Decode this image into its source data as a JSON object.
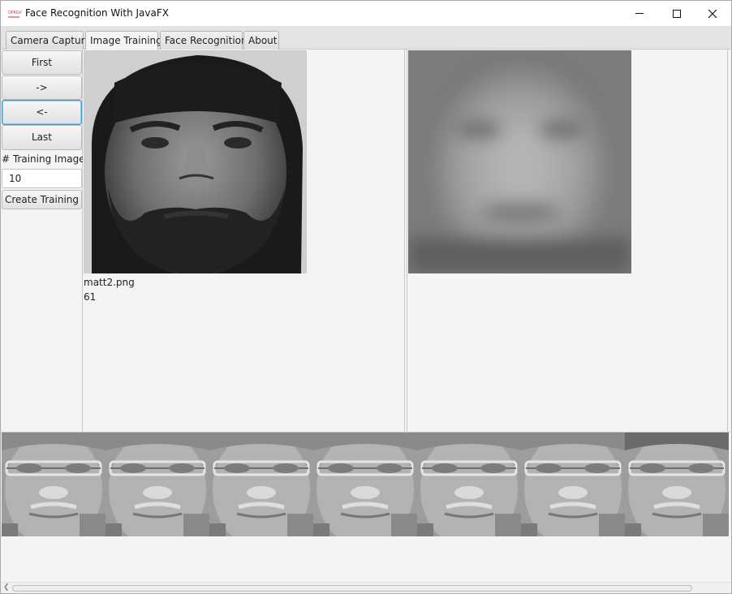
{
  "window": {
    "title": "Face Recognition With JavaFX",
    "icon_text": "OPRGV"
  },
  "tabs": [
    {
      "label": "Camera Capture"
    },
    {
      "label": "Image Training"
    },
    {
      "label": "Face Recognition"
    },
    {
      "label": "About"
    }
  ],
  "active_tab": "Image Training",
  "nav": {
    "first_label": "First",
    "next_label": "->",
    "prev_label": "<-",
    "last_label": "Last"
  },
  "training": {
    "count_label": "# Training Images",
    "count_value": "10",
    "create_label": "Create Training"
  },
  "current_image": {
    "filename": "matt2.png",
    "value": "61"
  }
}
